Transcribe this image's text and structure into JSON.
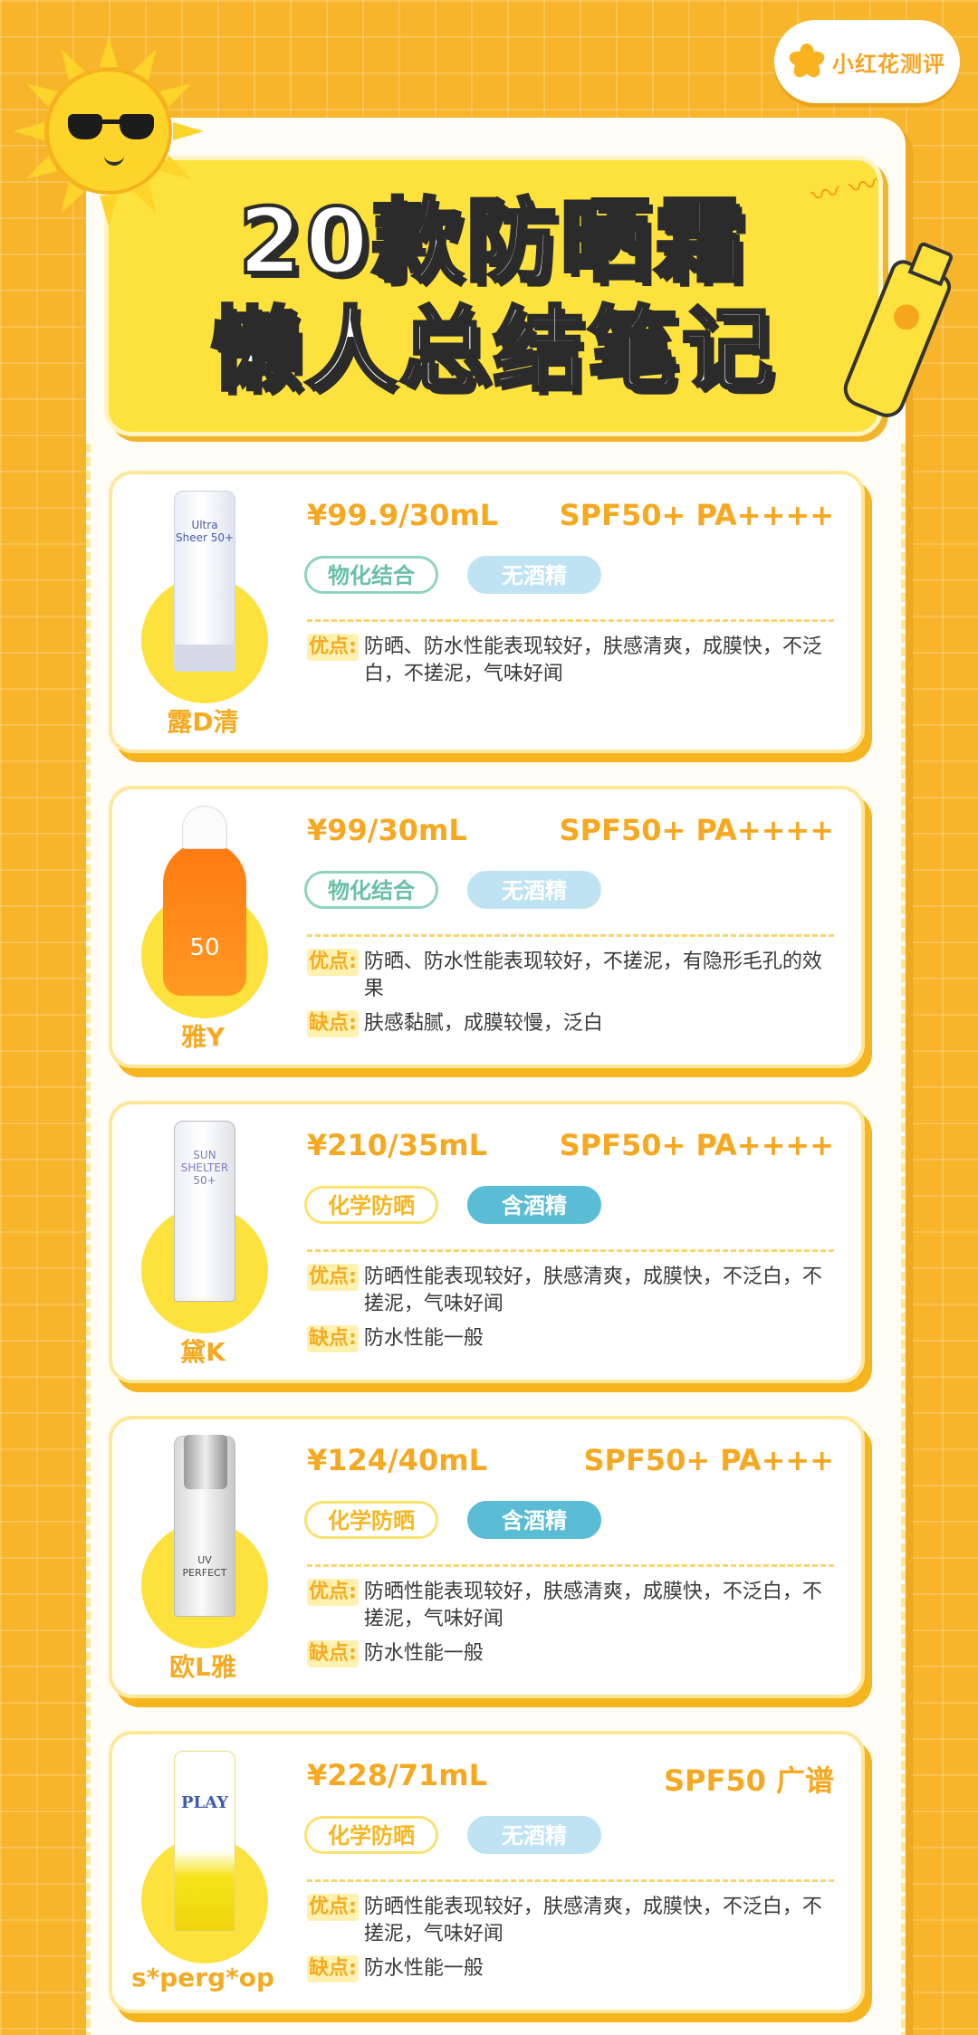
{
  "brand": {
    "name": "小红花测评"
  },
  "title": {
    "line1": "20款防晒霜",
    "line2": "懒人总结笔记"
  },
  "labels": {
    "pros": "优点:",
    "cons": "缺点:"
  },
  "products": [
    {
      "name": "露D清",
      "price": "¥99.9/30mL",
      "spf": "SPF50+ PA++++",
      "tag1": "物化结合",
      "tag2": "无酒精",
      "pros": "防晒、防水性能表现较好，肤感清爽，成膜快，不泛白，不搓泥，气味好闻",
      "cons": "",
      "bottle_text": "Ultra Sheer 50+"
    },
    {
      "name": "雅Y",
      "price": "¥99/30mL",
      "spf": "SPF50+ PA++++",
      "tag1": "物化结合",
      "tag2": "无酒精",
      "pros": "防晒、防水性能表现较好，不搓泥，有隐形毛孔的效果",
      "cons": "肤感黏腻，成膜较慢，泛白",
      "bottle_text": "50"
    },
    {
      "name": "黛K",
      "price": "¥210/35mL",
      "spf": "SPF50+ PA++++",
      "tag1": "化学防晒",
      "tag2": "含酒精",
      "pros": "防晒性能表现较好，肤感清爽，成膜快，不泛白，不搓泥，气味好闻",
      "cons": "防水性能一般",
      "bottle_text": "SUN SHELTER 50+"
    },
    {
      "name": "欧L雅",
      "price": "¥124/40mL",
      "spf": "SPF50+ PA+++",
      "tag1": "化学防晒",
      "tag2": "含酒精",
      "pros": "防晒性能表现较好，肤感清爽，成膜快，不泛白，不搓泥，气味好闻",
      "cons": "防水性能一般",
      "bottle_text": "UV PERFECT"
    },
    {
      "name": "s*perg*op",
      "price": "¥228/71mL",
      "spf": "SPF50 广谱",
      "tag1": "化学防晒",
      "tag2": "无酒精",
      "pros": "防晒性能表现较好，肤感清爽，成膜快，不泛白，不搓泥，气味好闻",
      "cons": "防水性能一般",
      "bottle_text": "PLAY"
    }
  ],
  "colors": {
    "background": "#f7b52c",
    "accent": "#f5a820",
    "title_bg": "#fde13d",
    "tag_green": "#69bfa7",
    "tag_blue": "#5bbcd5"
  },
  "icons": [
    "sun-icon",
    "sunglasses-icon",
    "sunscreen-tube-icon",
    "flower-logo-icon"
  ]
}
